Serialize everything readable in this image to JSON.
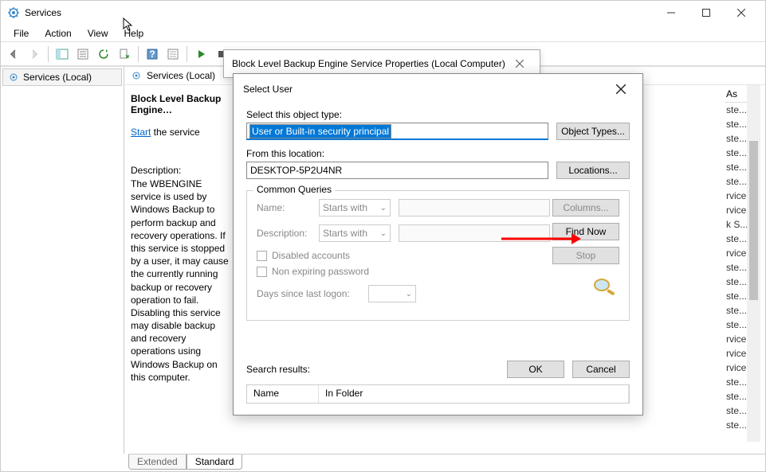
{
  "window": {
    "title": "Services",
    "menus": [
      "File",
      "Action",
      "View",
      "Help"
    ]
  },
  "leftPane": {
    "item": "Services (Local)"
  },
  "rightPane": {
    "header": "Services (Local)",
    "serviceName": "Block Level Backup Engine…",
    "startLink": "Start",
    "startText": " the service",
    "descLabel": "Description:",
    "description": "The WBENGINE service is used by Windows Backup to perform backup and recovery operations. If this service is stopped by a user, it may cause the currently running backup or recovery operation to fail. Disabling this service may disable backup and recovery operations using Windows Backup on this computer.",
    "listHeader": "As",
    "listRows": [
      "ste...",
      "ste...",
      "ste...",
      "ste...",
      "ste...",
      "ste...",
      "rvice",
      "rvice",
      "k S...",
      "ste...",
      "rvice",
      "ste...",
      "ste...",
      "ste...",
      "ste...",
      "ste...",
      "rvice",
      "rvice",
      "rvice",
      "ste...",
      "ste...",
      "ste...",
      "ste..."
    ],
    "tabs": {
      "extended": "Extended",
      "standard": "Standard"
    }
  },
  "propsDialog": {
    "title": "Block Level Backup Engine Service Properties (Local Computer)"
  },
  "selectDialog": {
    "title": "Select User",
    "objTypeLabel": "Select this object type:",
    "objTypeValue": "User or Built-in security principal",
    "objTypesBtn": "Object Types...",
    "locationLabel": "From this location:",
    "locationValue": "DESKTOP-5P2U4NR",
    "locationsBtn": "Locations...",
    "commonQueries": "Common Queries",
    "nameLabel": "Name:",
    "descLabel": "Description:",
    "startsWith": "Starts with",
    "disabled": "Disabled accounts",
    "nonExpiring": "Non expiring password",
    "daysSince": "Days since last logon:",
    "columnsBtn": "Columns...",
    "findNowBtn": "Find Now",
    "stopBtn": "Stop",
    "searchResults": "Search results:",
    "okBtn": "OK",
    "cancelBtn": "Cancel",
    "cols": {
      "name": "Name",
      "folder": "In Folder"
    }
  }
}
